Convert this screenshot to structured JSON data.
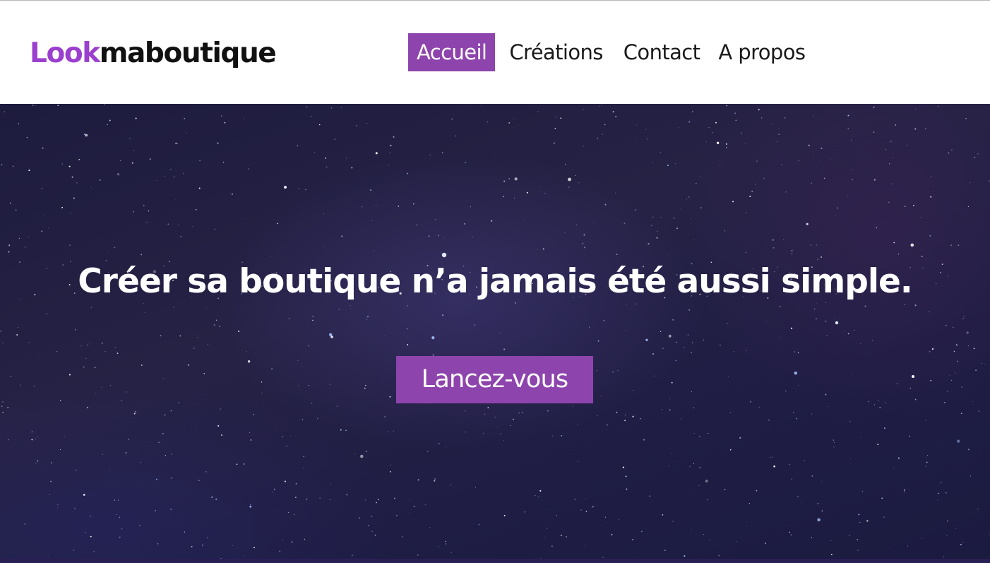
{
  "brand": {
    "accent_part": "Look",
    "rest_part": "maboutique",
    "accent_color": "#9b3fcf"
  },
  "nav": {
    "items": [
      {
        "label": "Accueil",
        "active": true
      },
      {
        "label": "Créations",
        "active": false
      },
      {
        "label": "Contact",
        "active": false
      },
      {
        "label": "A propos",
        "active": false
      }
    ],
    "active_color": "#8e44ad"
  },
  "hero": {
    "title": "Créer sa boutique n’a jamais été aussi simple.",
    "cta_label": "Lancez-vous",
    "cta_color": "#8e44ad",
    "background": "starry night sky"
  }
}
